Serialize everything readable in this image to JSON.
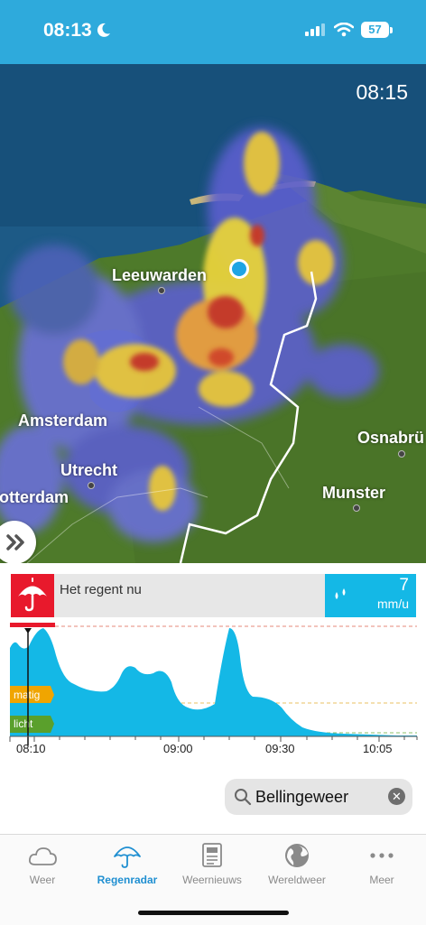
{
  "status_bar": {
    "time": "08:13",
    "battery": "57"
  },
  "map": {
    "timestamp": "08:15",
    "cities": [
      {
        "name": "Leeuwarden"
      },
      {
        "name": "Amsterdam"
      },
      {
        "name": "Utrecht"
      },
      {
        "name": "otterdam"
      },
      {
        "name": "Osnabrü"
      },
      {
        "name": "Munster"
      }
    ]
  },
  "rain": {
    "status_text": "Het regent nu",
    "amount": "7",
    "unit": "mm/u",
    "levels": {
      "moderate": "matig",
      "light": "licht"
    },
    "ticks": [
      "08:10",
      "09:00",
      "09:30",
      "10:05"
    ],
    "colors": {
      "heavy": "#e8192c",
      "moderate": "#f0a500",
      "light": "#5aa02c",
      "rain": "#14b8e6"
    }
  },
  "search": {
    "value": "Bellingeweer"
  },
  "tabs": [
    {
      "label": "Weer",
      "icon": "cloud-icon",
      "active": false
    },
    {
      "label": "Regenradar",
      "icon": "umbrella-icon",
      "active": true
    },
    {
      "label": "Weernieuws",
      "icon": "newspaper-icon",
      "active": false
    },
    {
      "label": "Wereldweer",
      "icon": "globe-icon",
      "active": false
    },
    {
      "label": "Meer",
      "icon": "more-icon",
      "active": false
    }
  ]
}
